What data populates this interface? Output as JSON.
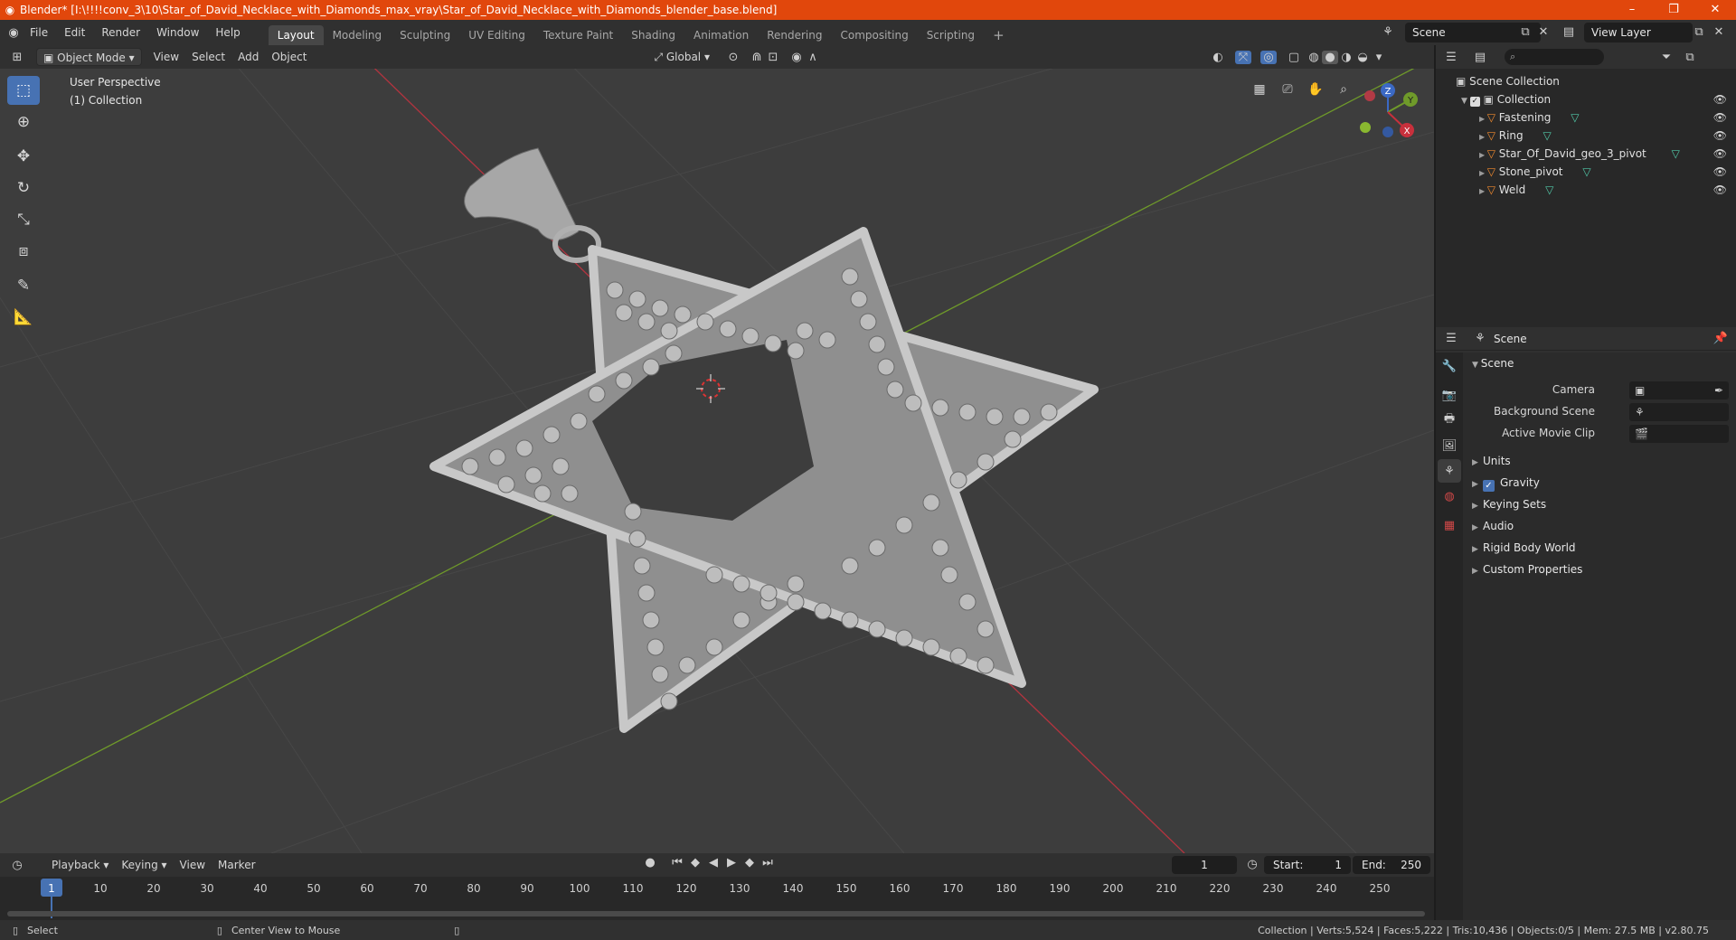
{
  "window": {
    "title": "Blender* [I:\\!!!!conv_3\\10\\Star_of_David_Necklace_with_Diamonds_max_vray\\Star_of_David_Necklace_with_Diamonds_blender_base.blend]",
    "minimize": "–",
    "maximize": "❐",
    "close": "✕"
  },
  "menu": [
    "File",
    "Edit",
    "Render",
    "Window",
    "Help"
  ],
  "workspaces": [
    "Layout",
    "Modeling",
    "Sculpting",
    "UV Editing",
    "Texture Paint",
    "Shading",
    "Animation",
    "Rendering",
    "Compositing",
    "Scripting"
  ],
  "add_workspace": "+",
  "scene_selector": "Scene",
  "view_layer_selector": "View Layer",
  "viewport_header": {
    "mode": "Object Mode",
    "menus": [
      "View",
      "Select",
      "Add",
      "Object"
    ],
    "transform_orientation": "Global"
  },
  "viewport": {
    "perspective_label": "User Perspective",
    "collection_label": "(1) Collection",
    "gizmo": {
      "x": "X",
      "y": "Y",
      "z": "Z"
    }
  },
  "outliner": {
    "root": "Scene Collection",
    "collection": "Collection",
    "items": [
      {
        "name": "Fastening"
      },
      {
        "name": "Ring"
      },
      {
        "name": "Star_Of_David_geo_3_pivot"
      },
      {
        "name": "Stone_pivot"
      },
      {
        "name": "Weld"
      }
    ]
  },
  "properties": {
    "context": "Scene",
    "panel_title": "Scene",
    "fields": [
      {
        "label": "Camera"
      },
      {
        "label": "Background Scene"
      },
      {
        "label": "Active Movie Clip"
      }
    ],
    "sections": [
      "Units",
      "Gravity",
      "Keying Sets",
      "Audio",
      "Rigid Body World",
      "Custom Properties"
    ]
  },
  "timeline": {
    "menus": [
      "Playback",
      "Keying",
      "View",
      "Marker"
    ],
    "current_frame": "1",
    "start_label": "Start:",
    "start_value": "1",
    "end_label": "End:",
    "end_value": "250",
    "ruler": [
      "1",
      "10",
      "20",
      "30",
      "40",
      "50",
      "60",
      "70",
      "80",
      "90",
      "100",
      "110",
      "120",
      "130",
      "140",
      "150",
      "160",
      "170",
      "180",
      "190",
      "200",
      "210",
      "220",
      "230",
      "240",
      "250"
    ]
  },
  "statusbar": {
    "select": "Select",
    "center_view": "Center View to Mouse",
    "stats": "Collection | Verts:5,524 | Faces:5,222 | Tris:10,436 | Objects:0/5 | Mem: 27.5 MB | v2.80.75"
  },
  "colors": {
    "title_bar": "#e1470c",
    "accent_blue": "#4772b3",
    "x_axis": "#b3343f",
    "y_axis": "#6f9a2a",
    "viewport_bg": "#3d3d3d"
  }
}
